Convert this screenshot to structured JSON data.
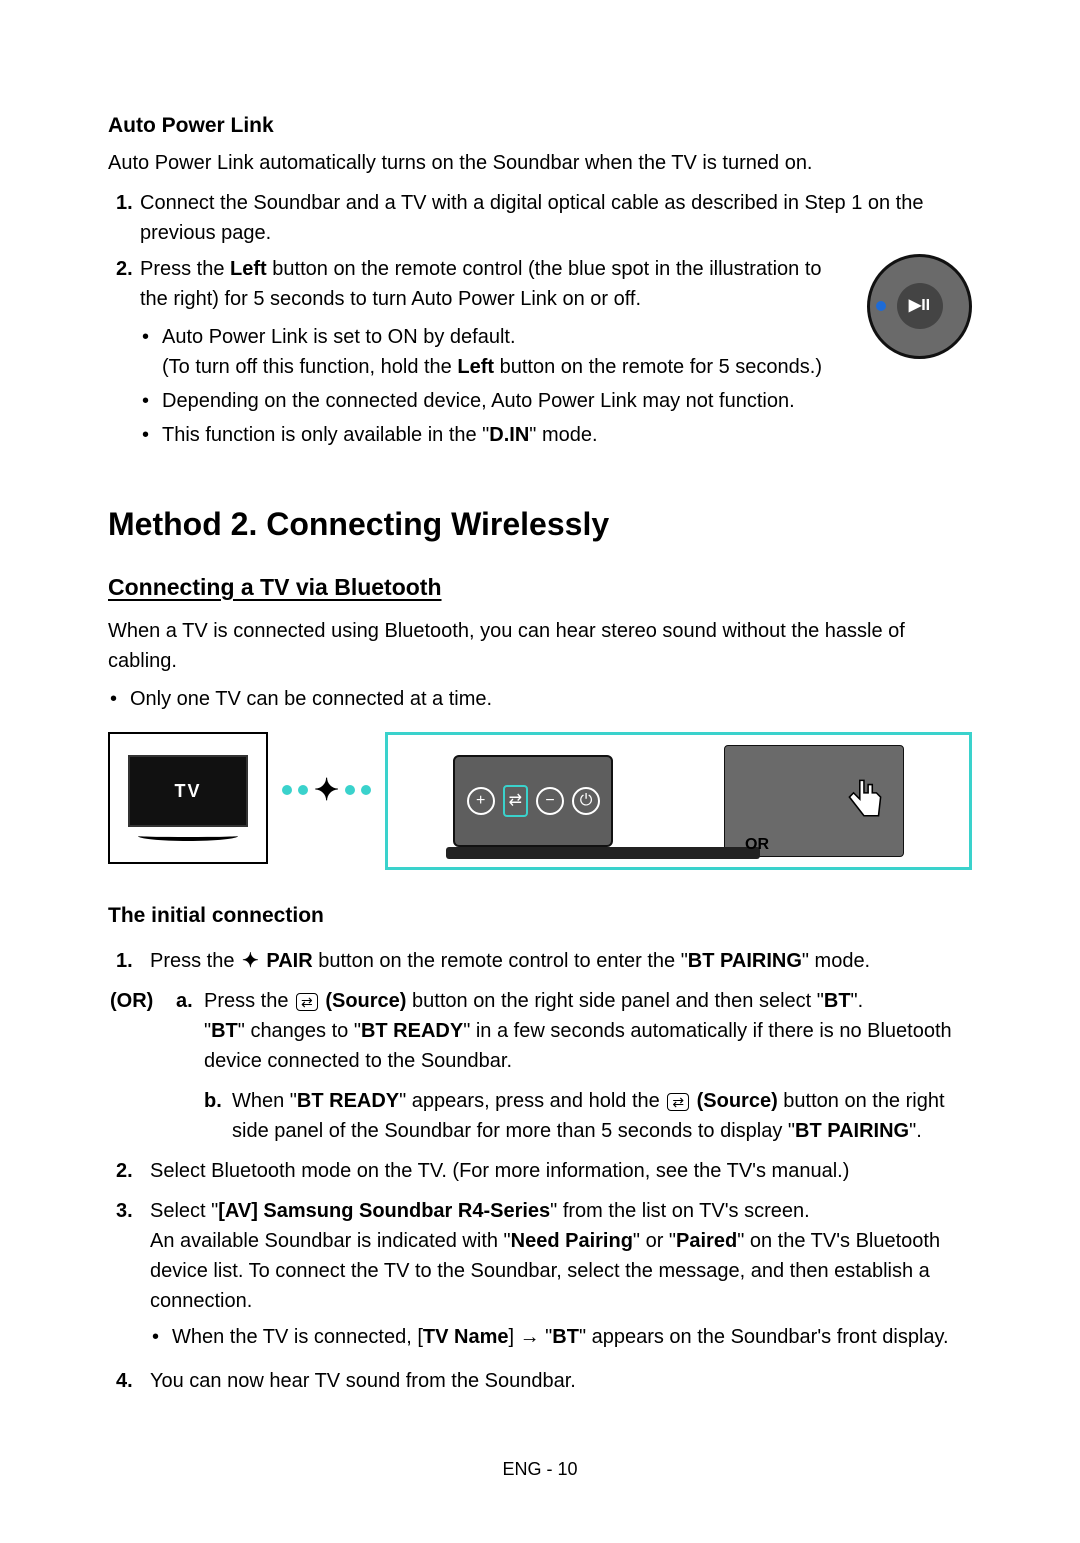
{
  "auto_power": {
    "title": "Auto Power Link",
    "desc": "Auto Power Link automatically turns on the Soundbar when the TV is turned on.",
    "step1_num": "1.",
    "step1": "Connect the Soundbar and a TV with a digital optical cable as described in Step 1 on the previous page.",
    "step2_num": "2.",
    "step2_a": "Press the ",
    "step2_left": "Left",
    "step2_b": " button on the remote control (the blue spot in the illustration to the right) for 5 seconds to turn Auto Power Link on or off.",
    "bullet1": "Auto Power Link is set to ON by default.",
    "bullet1_sub_a": "(To turn off this function, hold the ",
    "bullet1_sub_left": "Left",
    "bullet1_sub_b": " button on the remote for 5 seconds.)",
    "bullet2": "Depending on the connected device, Auto Power Link may not function.",
    "bullet3_a": "This function is only available in the \"",
    "bullet3_din": "D.IN",
    "bullet3_b": "\" mode.",
    "remote_label": "▶II"
  },
  "method2": {
    "title": "Method 2. Connecting Wirelessly",
    "sub_title": "Connecting a TV via Bluetooth",
    "intro": "When a TV is connected using Bluetooth, you can hear stereo sound without the hassle of cabling.",
    "bullet": "Only one TV can be connected at a time.",
    "tv_label": "TV",
    "or_label": "OR"
  },
  "initial": {
    "title": "The initial connection",
    "s1_num": "1.",
    "s1_a": "Press the ",
    "s1_pair": "PAIR",
    "s1_b": " button on the remote control to enter the \"",
    "s1_btpairing": "BT PAIRING",
    "s1_c": "\" mode.",
    "or_label": "(OR)",
    "a_letter": "a.",
    "a_1": "Press the ",
    "a_source": "(Source)",
    "a_2": " button on the right side panel and then select \"",
    "a_bt": "BT",
    "a_3": "\".",
    "a_line2_a": "\"",
    "a_line2_bt": "BT",
    "a_line2_b": "\" changes to \"",
    "a_line2_btready": "BT READY",
    "a_line2_c": "\" in a few seconds automatically if there is no Bluetooth device connected to the Soundbar.",
    "b_letter": "b.",
    "b_1": "When \"",
    "b_btready": "BT READY",
    "b_2": "\" appears, press and hold the ",
    "b_source": "(Source)",
    "b_3": " button on the right side panel of the Soundbar for more than 5 seconds to display \"",
    "b_btpairing": "BT PAIRING",
    "b_4": "\".",
    "s2_num": "2.",
    "s2": "Select Bluetooth mode on the TV. (For more information, see the TV's manual.)",
    "s3_num": "3.",
    "s3_a": "Select \"",
    "s3_device": "[AV] Samsung Soundbar R4-Series",
    "s3_b": "\" from the list on TV's screen.",
    "s3_line2_a": "An available Soundbar is indicated with \"",
    "s3_needpairing": "Need Pairing",
    "s3_line2_b": "\" or \"",
    "s3_paired": "Paired",
    "s3_line2_c": "\" on the TV's Bluetooth device list. To connect the TV to the Soundbar, select the message, and then establish a connection.",
    "s3_bullet_a": "When the TV is connected, [",
    "s3_tvname": "TV Name",
    "s3_bullet_b": "] → \"",
    "s3_bt": "BT",
    "s3_bullet_c": "\" appears on the Soundbar's front display.",
    "s4_num": "4.",
    "s4": "You can now hear TV sound from the Soundbar."
  },
  "footer": "ENG - 10"
}
